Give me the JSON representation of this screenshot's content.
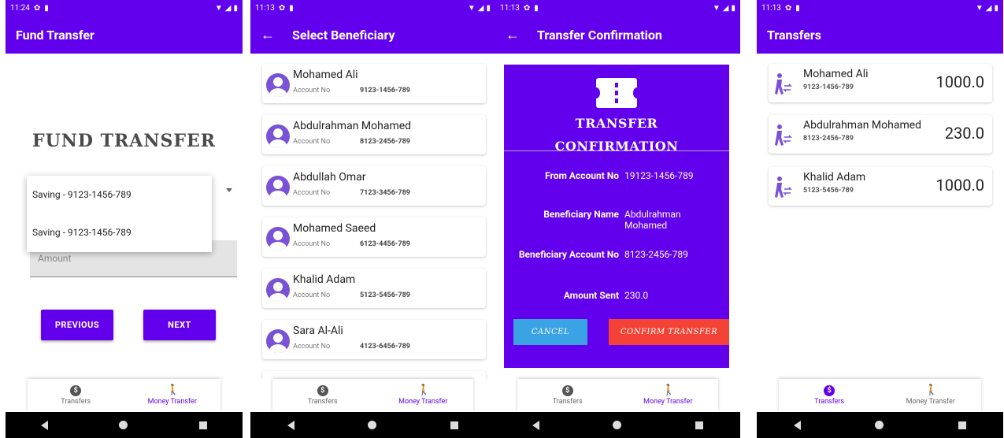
{
  "colors": {
    "primary": "#6200ee",
    "cancel": "#3aa3e3",
    "confirm": "#f44336"
  },
  "status": {
    "time1": "11:24",
    "time2": "11:13",
    "time3": "11:13",
    "time4": "11:13"
  },
  "nav_icons": [
    "back-icon",
    "home-icon",
    "recents-icon"
  ],
  "bottom_nav": {
    "transfers": "Transfers",
    "money_transfer": "Money Transfer"
  },
  "screen1": {
    "appbar_title": "Fund Transfer",
    "heading": "FUND TRANSFER",
    "selected_account": "Saving - 9123-1456-789",
    "dropdown_options": [
      "Saving - 9123-1456-789",
      "Saving - 9123-1456-789"
    ],
    "amount_placeholder": "Amount",
    "previous_label": "PREVIOUS",
    "next_label": "NEXT"
  },
  "screen2": {
    "appbar_title": "Select Beneficiary",
    "account_label": "Account No",
    "beneficiaries": [
      {
        "name": "Mohamed Ali",
        "account": "9123-1456-789"
      },
      {
        "name": "Abdulrahman Mohamed",
        "account": "8123-2456-789"
      },
      {
        "name": "Abdullah Omar",
        "account": "7123-3456-789"
      },
      {
        "name": "Mohamed Saeed",
        "account": "6123-4456-789"
      },
      {
        "name": "Khalid Adam",
        "account": "5123-5456-789"
      },
      {
        "name": "Sara Al-Ali",
        "account": "4123-6456-789"
      }
    ]
  },
  "screen3": {
    "appbar_title": "Transfer Confirmation",
    "heading_line1": "TRANSFER",
    "heading_line2": "CONFIRMATION",
    "from_label": "From Account No",
    "from_value": "19123-1456-789",
    "beneficiary_name_label": "Beneficiary Name",
    "beneficiary_name_value": "Abdulrahman Mohamed",
    "beneficiary_account_label": "Beneficiary Account No",
    "beneficiary_account_value": "8123-2456-789",
    "amount_label": "Amount Sent",
    "amount_value": "230.0",
    "cancel_label": "CANCEL",
    "confirm_label": "CONFIRM TRANSFER"
  },
  "screen4": {
    "appbar_title": "Transfers",
    "transfers": [
      {
        "name": "Mohamed Ali",
        "account": "9123-1456-789",
        "amount": "1000.0"
      },
      {
        "name": "Abdulrahman Mohamed",
        "account": "8123-2456-789",
        "amount": "230.0"
      },
      {
        "name": "Khalid Adam",
        "account": "5123-5456-789",
        "amount": "1000.0"
      }
    ]
  }
}
